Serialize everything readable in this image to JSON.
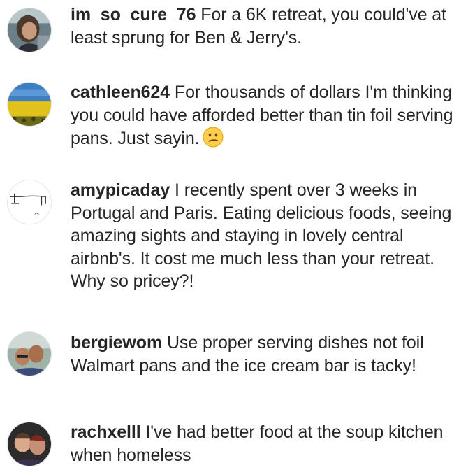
{
  "comments": [
    {
      "username": "im_so_cure_76",
      "text": "For a 6K retreat, you could've at least sprung for Ben & Jerry's.",
      "avatar": "woman-portrait-avatar"
    },
    {
      "username": "cathleen624",
      "text": "For thousands of dollars I'm thinking you could have afforded better than tin foil serving pans.  Just sayin.",
      "emoji": "confused-face-emoji",
      "avatar": "sunflower-field-avatar"
    },
    {
      "username": "amypicaday",
      "text": "I recently spent over 3 weeks in Portugal and Paris. Eating delicious foods, seeing amazing sights and staying in lovely central airbnb's. It cost me much less than your retreat. Why so pricey?!",
      "avatar": "sketch-drawing-avatar"
    },
    {
      "username": "bergiewom",
      "text": "Use proper serving dishes not foil Walmart pans and the ice cream bar is tacky!",
      "avatar": "couple-selfie-avatar"
    },
    {
      "username": "rachxelll",
      "text": "I've had better food at the soup kitchen when homeless",
      "avatar": "two-kids-avatar"
    }
  ]
}
